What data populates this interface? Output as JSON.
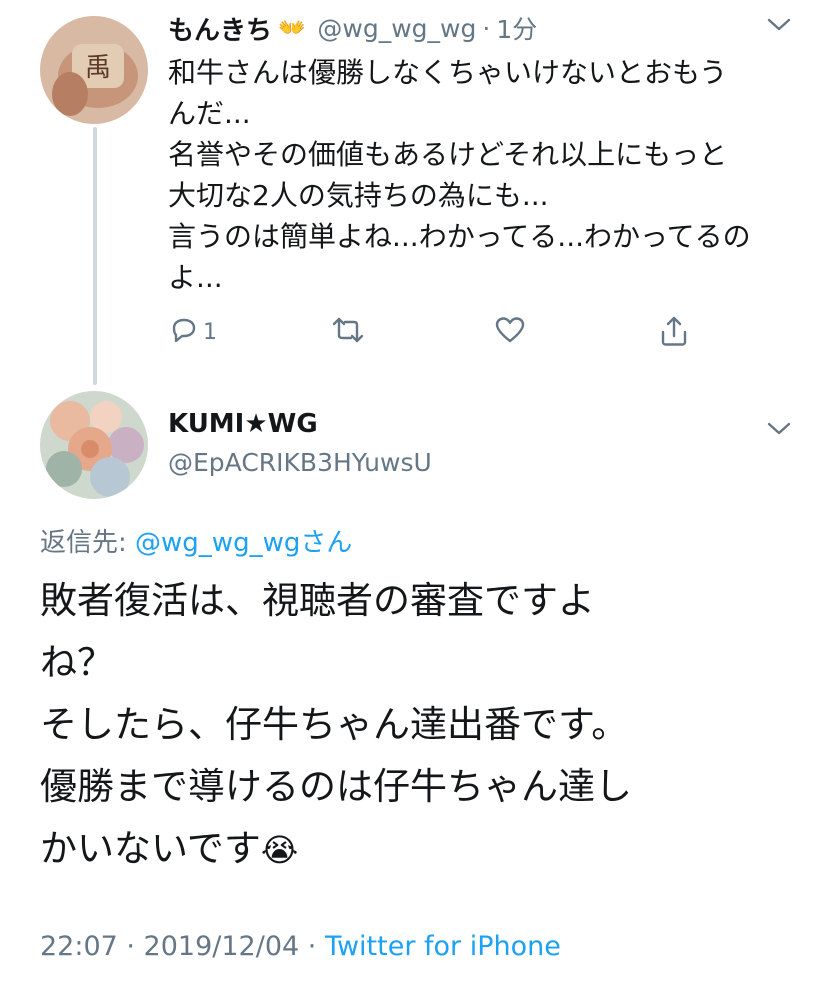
{
  "colors": {
    "accent": "#1da1f2",
    "muted": "#657786",
    "text": "#14171a"
  },
  "parent_tweet": {
    "name": "もんきち",
    "emoji": "👐",
    "handle": "@wg_wg_wg",
    "separator": "·",
    "time": "1分",
    "text": "和牛さんは優勝しなくちゃいけないとおもう\nんだ...\n名誉やその価値もあるけどそれ以上にもっと\n大切な2人の気持ちの為にも...\n言うのは簡単よね...わかってる...わかってるの\nよ...",
    "reply_count": "1",
    "icons": [
      "reply-icon",
      "retweet-icon",
      "like-icon",
      "share-icon",
      "chevron-down-icon"
    ]
  },
  "main_tweet": {
    "name": "KUMI★WG",
    "handle": "@EpACRIKB3HYuwsU",
    "replying_to_label": "返信先: ",
    "replying_to_handle": "@wg_wg_wg",
    "replying_to_suffix": "さん",
    "text": "敗者復活は、視聴者の審査ですよ\nね？\nそしたら、仔牛ちゃん達出番です。\n優勝まで導けるのは仔牛ちゃん達し\nかいないです",
    "emoji": "😭",
    "timestamp": "22:07 · 2019/12/04 · ",
    "source": "Twitter for iPhone"
  }
}
